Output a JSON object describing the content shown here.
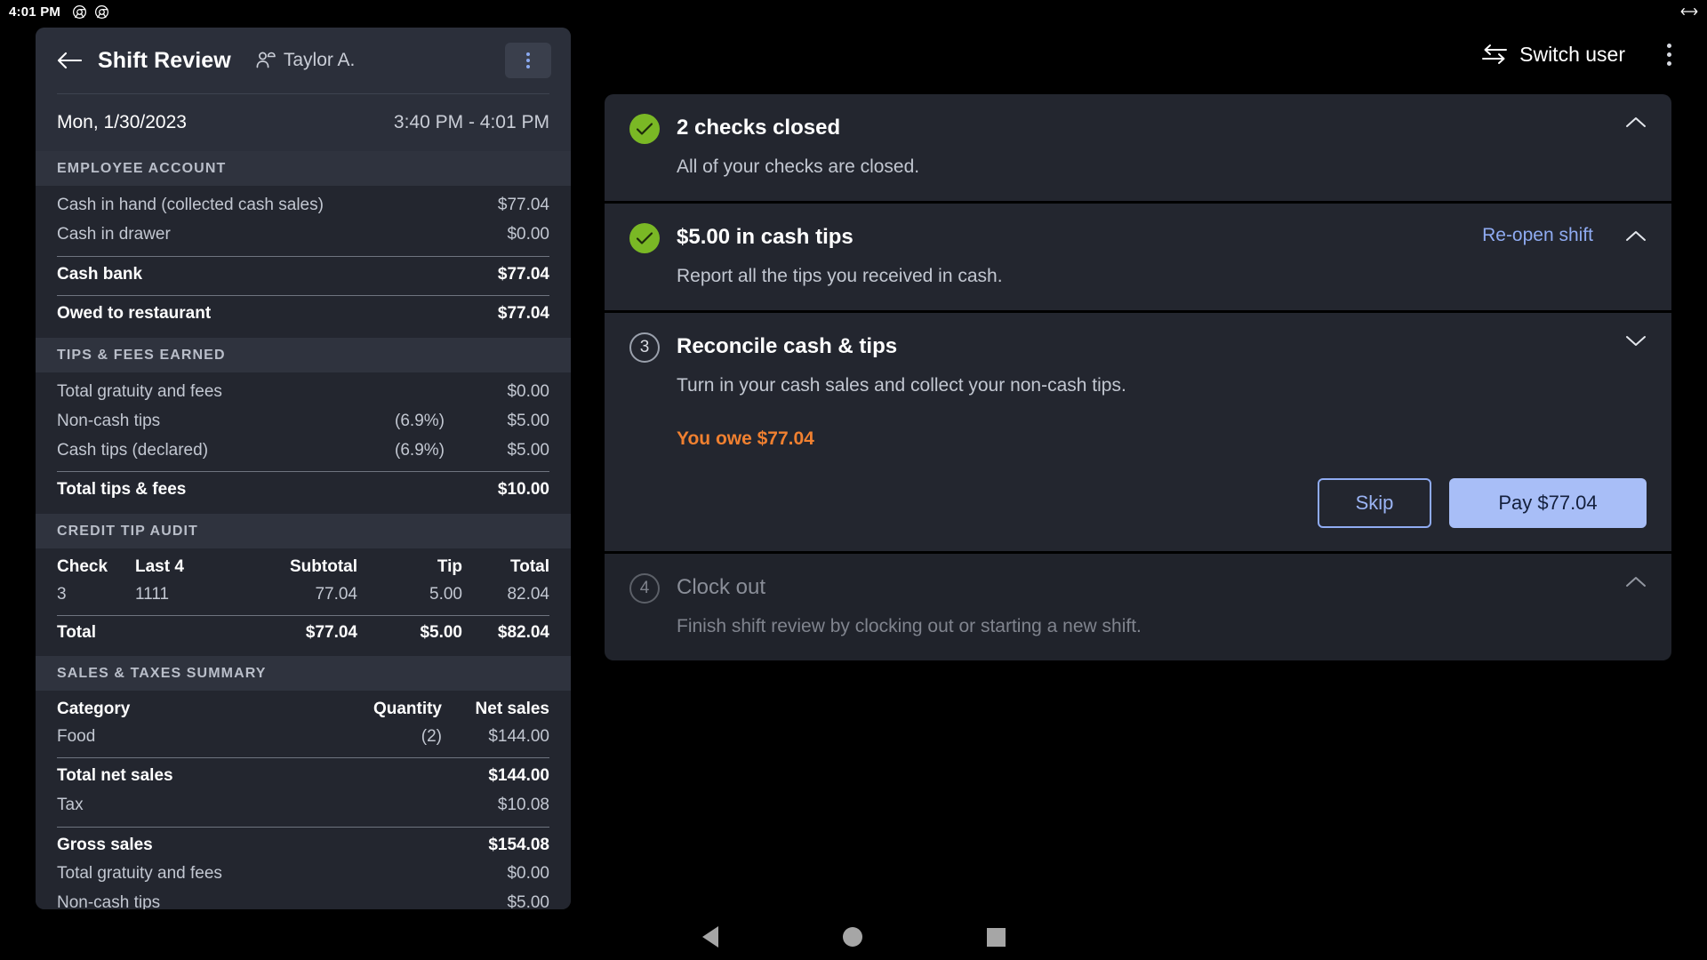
{
  "statusbar": {
    "time": "4:01 PM",
    "icons": [
      "chrome-icon",
      "chrome-icon"
    ],
    "right_icon": "resize-horizontal-icon"
  },
  "topbar": {
    "switch_user_label": "Switch user",
    "switch_user_icon": "swap-arrows-icon",
    "overflow_icon": "more-vertical-icon"
  },
  "shift_panel": {
    "back_icon": "arrow-left-icon",
    "title": "Shift Review",
    "user_icon": "person-icon",
    "user_name": "Taylor A.",
    "overflow_icon": "more-vertical-icon",
    "date": "Mon, 1/30/2023",
    "time_range": "3:40 PM - 4:01 PM",
    "sections": {
      "employee_account": {
        "heading": "EMPLOYEE ACCOUNT",
        "rows": [
          {
            "label": "Cash in hand (collected cash sales)",
            "amount": "$77.04",
            "bold": false,
            "rule_after": false
          },
          {
            "label": "Cash in drawer",
            "amount": "$0.00",
            "bold": false,
            "rule_after": true
          },
          {
            "label": "Cash bank",
            "amount": "$77.04",
            "bold": true,
            "rule_after": true
          },
          {
            "label": "Owed to restaurant",
            "amount": "$77.04",
            "bold": true,
            "rule_after": false
          }
        ]
      },
      "tips_fees": {
        "heading": "TIPS & FEES EARNED",
        "rows": [
          {
            "label": "Total gratuity and fees",
            "pct": "",
            "amount": "$0.00",
            "bold": false,
            "rule_after": false
          },
          {
            "label": "Non-cash tips",
            "pct": "(6.9%)",
            "amount": "$5.00",
            "bold": false,
            "rule_after": false
          },
          {
            "label": "Cash tips (declared)",
            "pct": "(6.9%)",
            "amount": "$5.00",
            "bold": false,
            "rule_after": true
          },
          {
            "label": "Total tips & fees",
            "pct": "",
            "amount": "$10.00",
            "bold": true,
            "rule_after": false
          }
        ]
      },
      "credit_tip_audit": {
        "heading": "CREDIT TIP AUDIT",
        "columns": [
          "Check",
          "Last 4",
          "Subtotal",
          "Tip",
          "Total"
        ],
        "rows": [
          [
            "3",
            "1111",
            "77.04",
            "5.00",
            "82.04"
          ]
        ],
        "total_row": [
          "Total",
          "",
          "$77.04",
          "$5.00",
          "$82.04"
        ]
      },
      "sales_taxes": {
        "heading": "SALES & TAXES SUMMARY",
        "columns": [
          "Category",
          "Quantity",
          "Net sales"
        ],
        "rows": [
          [
            "Food",
            "(2)",
            "$144.00"
          ]
        ],
        "summary_rows": [
          {
            "label": "Total net sales",
            "amount": "$144.00",
            "bold": true,
            "rule_after": false
          },
          {
            "label": "Tax",
            "amount": "$10.08",
            "bold": false,
            "rule_after": true
          },
          {
            "label": "Gross sales",
            "amount": "$154.08",
            "bold": true,
            "rule_after": false
          },
          {
            "label": "Total gratuity and fees",
            "amount": "$0.00",
            "bold": false,
            "rule_after": false
          },
          {
            "label": "Non-cash tips",
            "amount": "$5.00",
            "bold": false,
            "rule_after": false
          }
        ]
      }
    }
  },
  "checklist": {
    "cards": [
      {
        "status": "done",
        "badge_icon": "check-circle-icon",
        "title": "2 checks closed",
        "description": "All of your checks are closed.",
        "chevron": "chevron-up-icon",
        "link": ""
      },
      {
        "status": "done",
        "badge_icon": "check-circle-icon",
        "title": "$5.00 in cash tips",
        "description": "Report all the tips you received in cash.",
        "chevron": "chevron-up-icon",
        "link": "Re-open shift"
      },
      {
        "status": "active",
        "badge_number": "3",
        "title": "Reconcile cash & tips",
        "description": "Turn in your cash sales and collect your non-cash tips.",
        "chevron": "chevron-down-icon",
        "owed_text": "You owe $77.04",
        "skip_label": "Skip",
        "pay_label": "Pay $77.04"
      },
      {
        "status": "disabled",
        "badge_number": "4",
        "title": "Clock out",
        "description": "Finish shift review by clocking out or starting a new shift.",
        "chevron": "chevron-up-icon",
        "link": ""
      }
    ]
  },
  "navbar": {
    "back": "back-triangle-icon",
    "home": "home-circle-icon",
    "recents": "recents-square-icon"
  },
  "colors": {
    "accent_blue": "#8FABF2",
    "pay_button": "#A8BEF7",
    "warning_orange": "#F08030",
    "success_green": "#7AB825",
    "panel_bg": "#23262F",
    "section_header_bg": "#2F333E"
  }
}
